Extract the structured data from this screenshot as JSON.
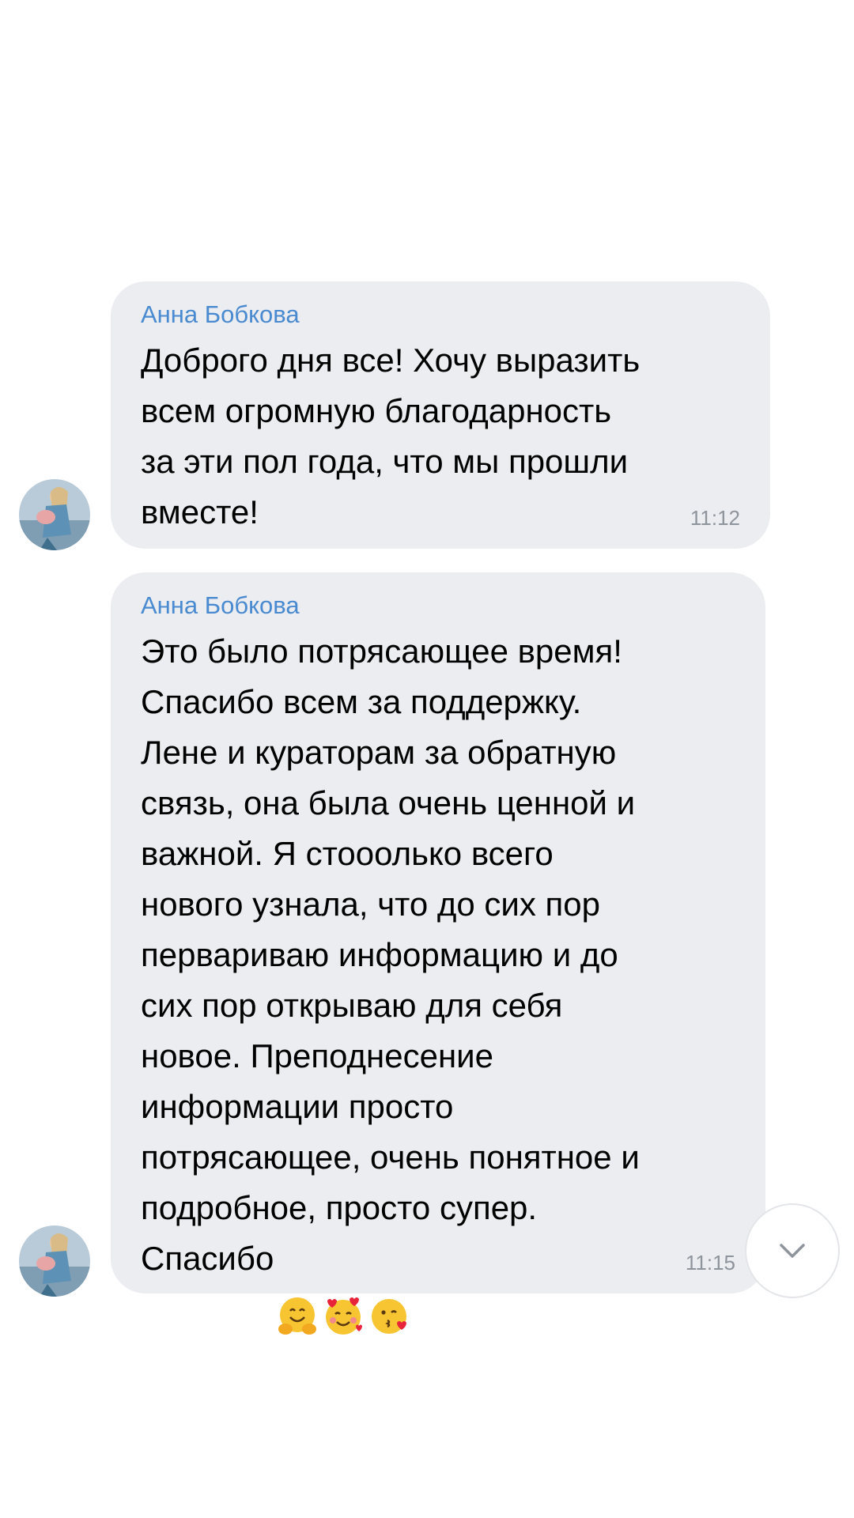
{
  "messages": [
    {
      "sender": "Анна Бобкова",
      "text": "Доброго дня все! Хочу выразить\nвсем огромную благодарность\nза эти пол года, что мы прошли\nвместе!",
      "time": "11:12"
    },
    {
      "sender": "Анна Бобкова",
      "text": "Это было потрясающее время!\nСпасибо всем за поддержку.\nЛене и кураторам за обратную\nсвязь, она была очень ценной и\nважной. Я стооолько всего\nнового узнала, что до сих пор\nпервариваю информацию и до\nсих пор открываю для себя\nновое. Преподнесение\nинформации просто\nпотрясающее, очень понятное и\nподробное, просто супер.\nСпасибо",
      "emojis": [
        "hugging-face-emoji",
        "smiling-face-with-hearts-emoji",
        "face-blowing-kiss-emoji"
      ],
      "time": "11:15"
    }
  ],
  "scroll_button": {
    "icon": "chevron-down-icon"
  },
  "colors": {
    "bubble": "#ebedf0",
    "sender_name": "#4a8ad0",
    "time": "#8e949c",
    "background": "#ffffff"
  }
}
